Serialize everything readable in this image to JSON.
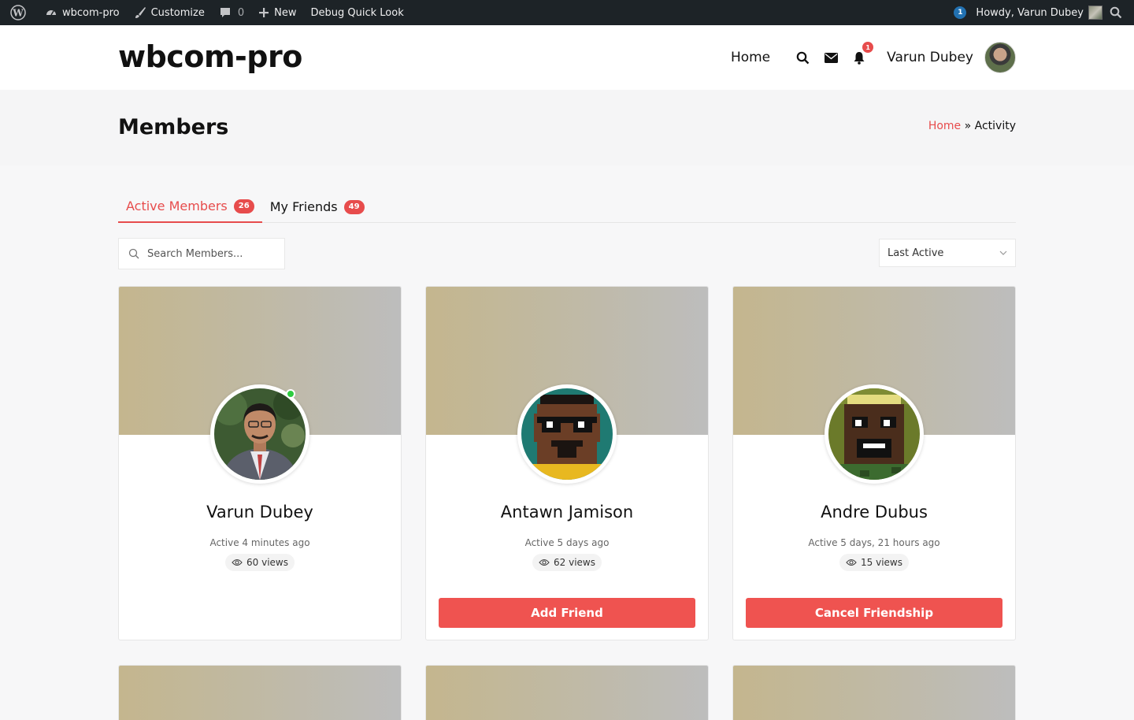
{
  "adminbar": {
    "site_name": "wbcom-pro",
    "customize": "Customize",
    "comments_count": "0",
    "new_label": "New",
    "debug_label": "Debug Quick Look",
    "notif_count": "1",
    "howdy": "Howdy, Varun Dubey"
  },
  "header": {
    "site_title": "wbcom-pro",
    "nav_home": "Home",
    "notif_count": "1",
    "user_name": "Varun Dubey"
  },
  "page": {
    "title": "Members",
    "breadcrumb_home": "Home",
    "breadcrumb_sep": " » ",
    "breadcrumb_current": "Activity"
  },
  "tabs": [
    {
      "label": "Active Members",
      "count": "26",
      "active": true
    },
    {
      "label": "My Friends",
      "count": "49",
      "active": false
    }
  ],
  "search": {
    "placeholder": "Search Members..."
  },
  "filter": {
    "selected": "Last Active"
  },
  "members": [
    {
      "name": "Varun Dubey",
      "active": "Active 4 minutes ago",
      "views": "60 views",
      "button": "",
      "online": true
    },
    {
      "name": "Antawn Jamison",
      "active": "Active 5 days ago",
      "views": "62 views",
      "button": "Add Friend",
      "online": false
    },
    {
      "name": "Andre Dubus",
      "active": "Active 5 days, 21 hours ago",
      "views": "15 views",
      "button": "Cancel Friendship",
      "online": false
    }
  ],
  "colors": {
    "accent": "#e74c4c",
    "button": "#ef5350",
    "online": "#2ecc40",
    "adminbar": "#1d2327"
  }
}
